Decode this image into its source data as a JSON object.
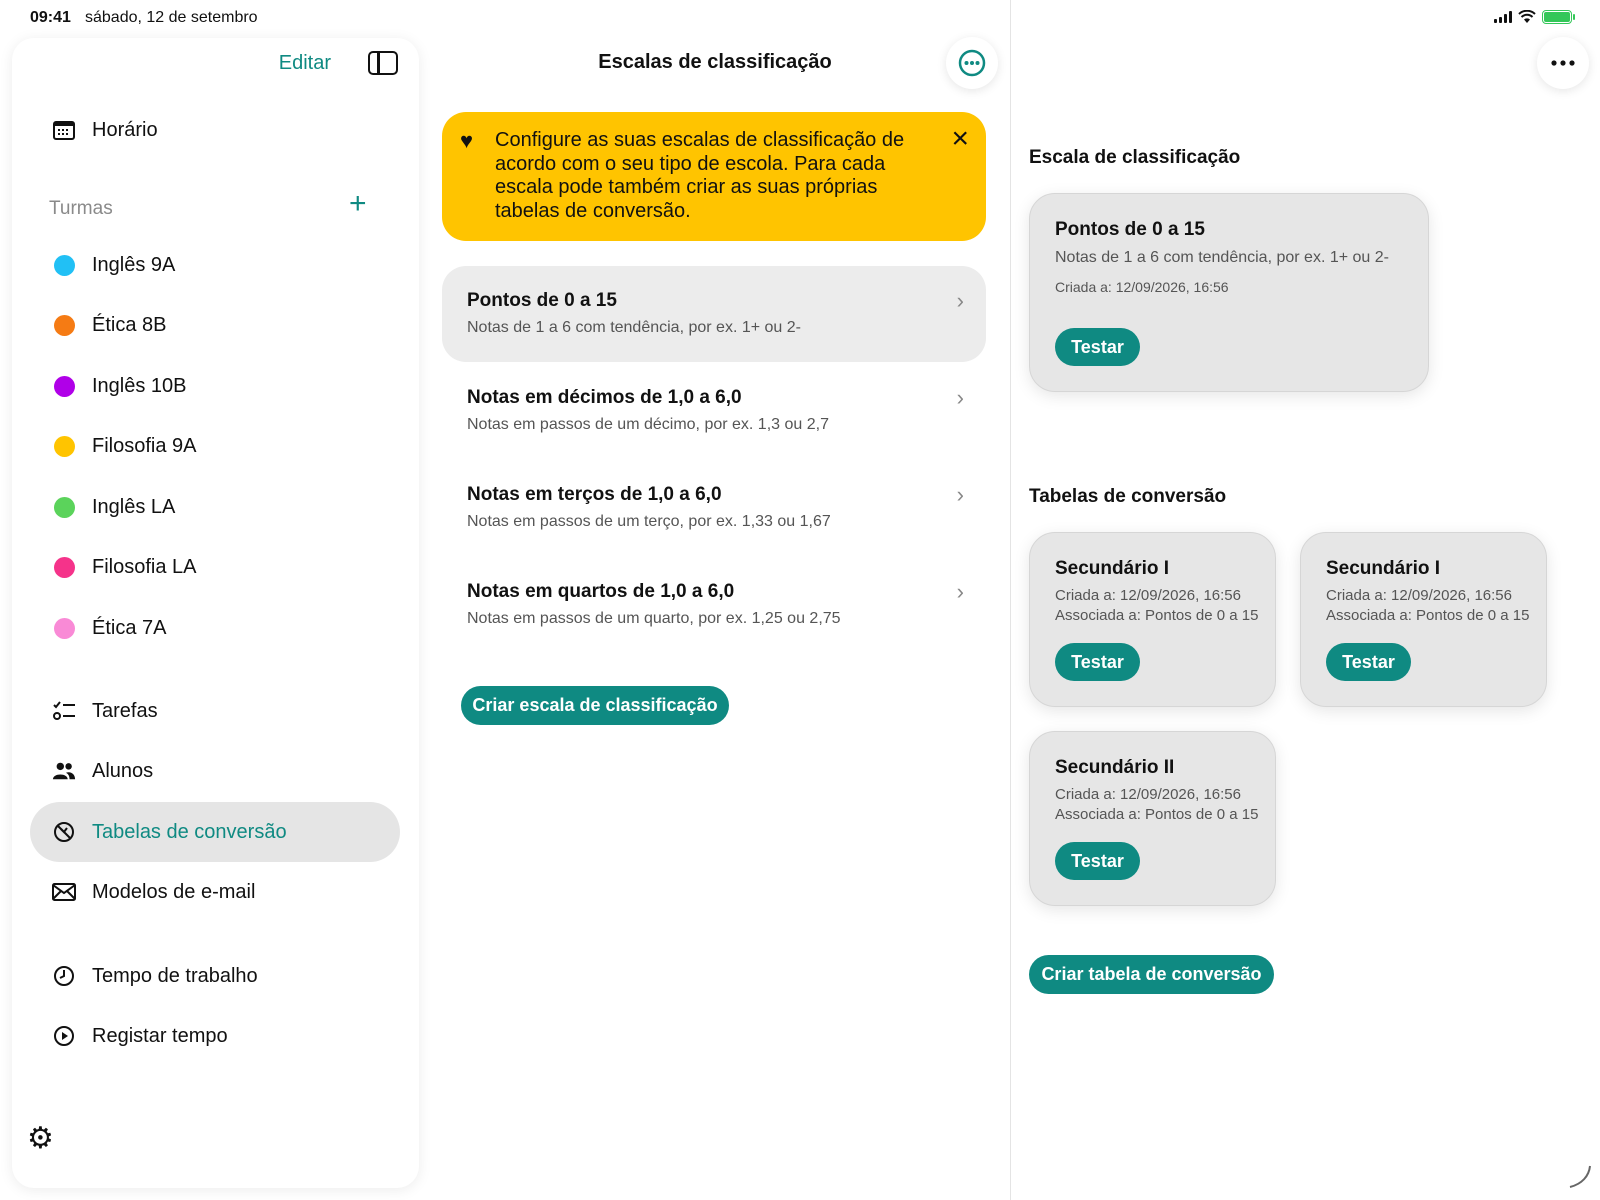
{
  "status": {
    "time": "09:41",
    "date": "sábado, 12 de setembro"
  },
  "sidebar": {
    "edit_label": "Editar",
    "schedule_label": "Horário",
    "classes_section": "Turmas",
    "classes": [
      {
        "label": "Inglês 9A",
        "color": "#21c0f5"
      },
      {
        "label": "Ética 8B",
        "color": "#f57b14"
      },
      {
        "label": "Inglês 10B",
        "color": "#b000e8"
      },
      {
        "label": "Filosofia 9A",
        "color": "#ffc400"
      },
      {
        "label": "Inglês LA",
        "color": "#5bd35b"
      },
      {
        "label": "Filosofia LA",
        "color": "#f5338a"
      },
      {
        "label": "Ética 7A",
        "color": "#f98ad6"
      }
    ],
    "nav": [
      {
        "label": "Tarefas",
        "icon": "checklist-icon"
      },
      {
        "label": "Alunos",
        "icon": "people-icon"
      },
      {
        "label": "Tabelas de conversão",
        "icon": "conversion-icon",
        "active": true
      },
      {
        "label": "Modelos de e-mail",
        "icon": "envelope-icon"
      }
    ],
    "time_nav": [
      {
        "label": "Tempo de trabalho",
        "icon": "clock-icon"
      },
      {
        "label": "Registar tempo",
        "icon": "play-icon"
      }
    ]
  },
  "middle": {
    "title": "Escalas de classificação",
    "banner_text": "Configure as suas escalas de classificação de acordo com o seu tipo de escola. Para cada escala pode também criar as suas próprias tabelas de conversão.",
    "scales": [
      {
        "title": "Pontos de 0 a 15",
        "subtitle": "Notas de 1 a 6 com tendência, por ex. 1+ ou 2-",
        "selected": true
      },
      {
        "title": "Notas em décimos de 1,0 a 6,0",
        "subtitle": "Notas em passos de um décimo, por ex. 1,3 ou 2,7"
      },
      {
        "title": "Notas em terços de 1,0 a 6,0",
        "subtitle": "Notas em passos de um terço, por ex. 1,33 ou 1,67"
      },
      {
        "title": "Notas em quartos de 1,0 a 6,0",
        "subtitle": "Notas em passos de um quarto, por ex. 1,25 ou 2,75"
      }
    ],
    "create_button": "Criar escala de classificação"
  },
  "right": {
    "scale_heading": "Escala de classificação",
    "scale_card": {
      "title": "Pontos de 0 a 15",
      "subtitle": "Notas de 1 a 6 com tendência, por ex. 1+ ou 2-",
      "created": "Criada a: 12/09/2026, 16:56",
      "button": "Testar"
    },
    "tables_heading": "Tabelas de conversão",
    "tables": [
      {
        "title": "Secundário I",
        "created": "Criada a: 12/09/2026, 16:56",
        "linked": "Associada a: Pontos de 0 a 15",
        "button": "Testar"
      },
      {
        "title": "Secundário I",
        "created": "Criada a: 12/09/2026, 16:56",
        "linked": "Associada a: Pontos de 0 a 15",
        "button": "Testar"
      },
      {
        "title": "Secundário II",
        "created": "Criada a: 12/09/2026, 16:56",
        "linked": "Associada a: Pontos de 0 a 15",
        "button": "Testar"
      }
    ],
    "create_button": "Criar tabela de conversão"
  },
  "colors": {
    "accent": "#0f8a82",
    "banner": "#ffc400",
    "selected_bg": "#ececec"
  }
}
